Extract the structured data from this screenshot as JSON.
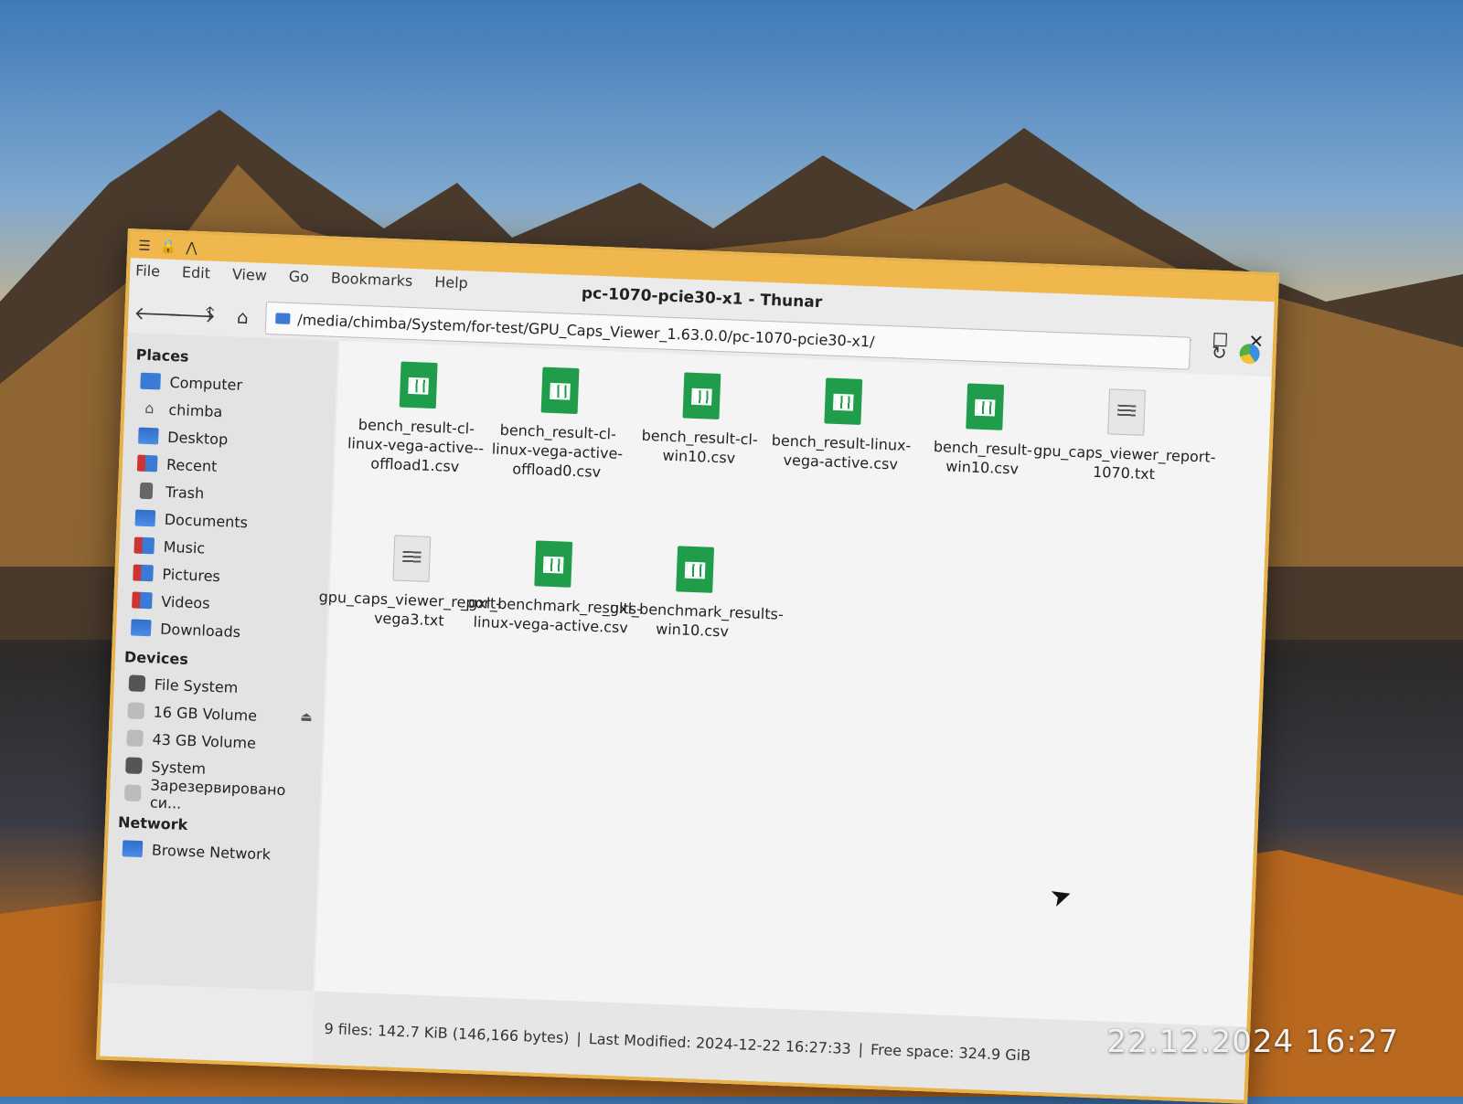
{
  "window": {
    "title": "pc-1070-pcie30-x1 - Thunar",
    "titlebar_icons": [
      "☰",
      "🔒",
      "⋀"
    ],
    "controls": {
      "minimize": "—",
      "maximize": "☐",
      "close": "✕"
    }
  },
  "menu": [
    "File",
    "Edit",
    "View",
    "Go",
    "Bookmarks",
    "Help"
  ],
  "toolbar": {
    "back": "🡐",
    "forward": "🡒",
    "up": "🡑",
    "home": "⌂",
    "path": "/media/chimba/System/for-test/GPU_Caps_Viewer_1.63.0.0/pc-1070-pcie30-x1/",
    "reload": "↻"
  },
  "sidebar": {
    "places_heading": "Places",
    "places": [
      "Computer",
      "chimba",
      "Desktop",
      "Recent",
      "Trash",
      "Documents",
      "Music",
      "Pictures",
      "Videos",
      "Downloads"
    ],
    "devices_heading": "Devices",
    "devices": [
      "File System",
      "16 GB Volume",
      "43 GB Volume",
      "System",
      "Зарезервировано си..."
    ],
    "network_heading": "Network",
    "network": [
      "Browse Network"
    ]
  },
  "files": [
    {
      "name": "bench_result-cl-linux-vega-active--offload1.csv",
      "type": "sheet"
    },
    {
      "name": "bench_result-cl-linux-vega-active-offload0.csv",
      "type": "sheet"
    },
    {
      "name": "bench_result-cl-win10.csv",
      "type": "sheet"
    },
    {
      "name": "bench_result-linux-vega-active.csv",
      "type": "sheet"
    },
    {
      "name": "bench_result-win10.csv",
      "type": "sheet"
    },
    {
      "name": "gpu_caps_viewer_report-1070.txt",
      "type": "text"
    },
    {
      "name": "gpu_caps_viewer_report-vega3.txt",
      "type": "text"
    },
    {
      "name": "_gxl_benchmark_results-linux-vega-active.csv",
      "type": "sheet"
    },
    {
      "name": "_gxl_benchmark_results-win10.csv",
      "type": "sheet"
    }
  ],
  "status": {
    "files": "9 files: 142.7 KiB (146,166 bytes)",
    "modified": "Last Modified: 2024-12-22 16:27:33",
    "free": "Free space: 324.9 GiB",
    "sep": "|"
  },
  "photo_timestamp": "22.12.2024 16:27"
}
